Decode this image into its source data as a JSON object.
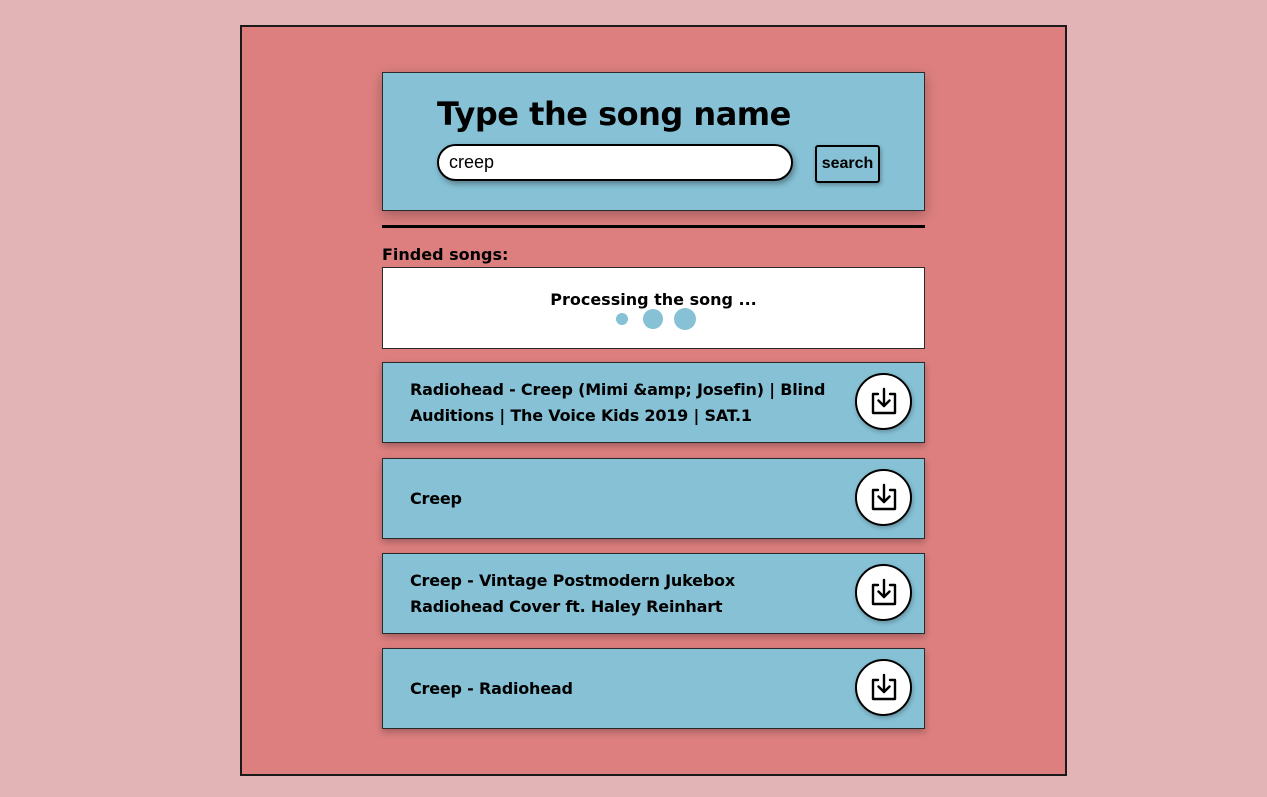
{
  "search": {
    "title": "Type the song name",
    "input_value": "creep",
    "button_label": "search"
  },
  "results": {
    "label": "Finded songs:",
    "processing_text": "Processing the song ...",
    "songs": [
      {
        "title": "Radiohead - Creep (Mimi &amp; Josefin) | Blind Auditions | The Voice Kids 2019 | SAT.1",
        "icon": "download-icon"
      },
      {
        "title": "Creep",
        "icon": "download-icon"
      },
      {
        "title": "Creep - Vintage Postmodern Jukebox Radiohead Cover ft. Haley Reinhart",
        "icon": "download-icon"
      },
      {
        "title": "Creep - Radiohead",
        "icon": "download-icon"
      }
    ]
  },
  "colors": {
    "page_background": "#e2b4b5",
    "frame_background": "#dd7f7f",
    "panel_blue": "#86c1d5",
    "white": "#ffffff",
    "text": "#000000"
  }
}
